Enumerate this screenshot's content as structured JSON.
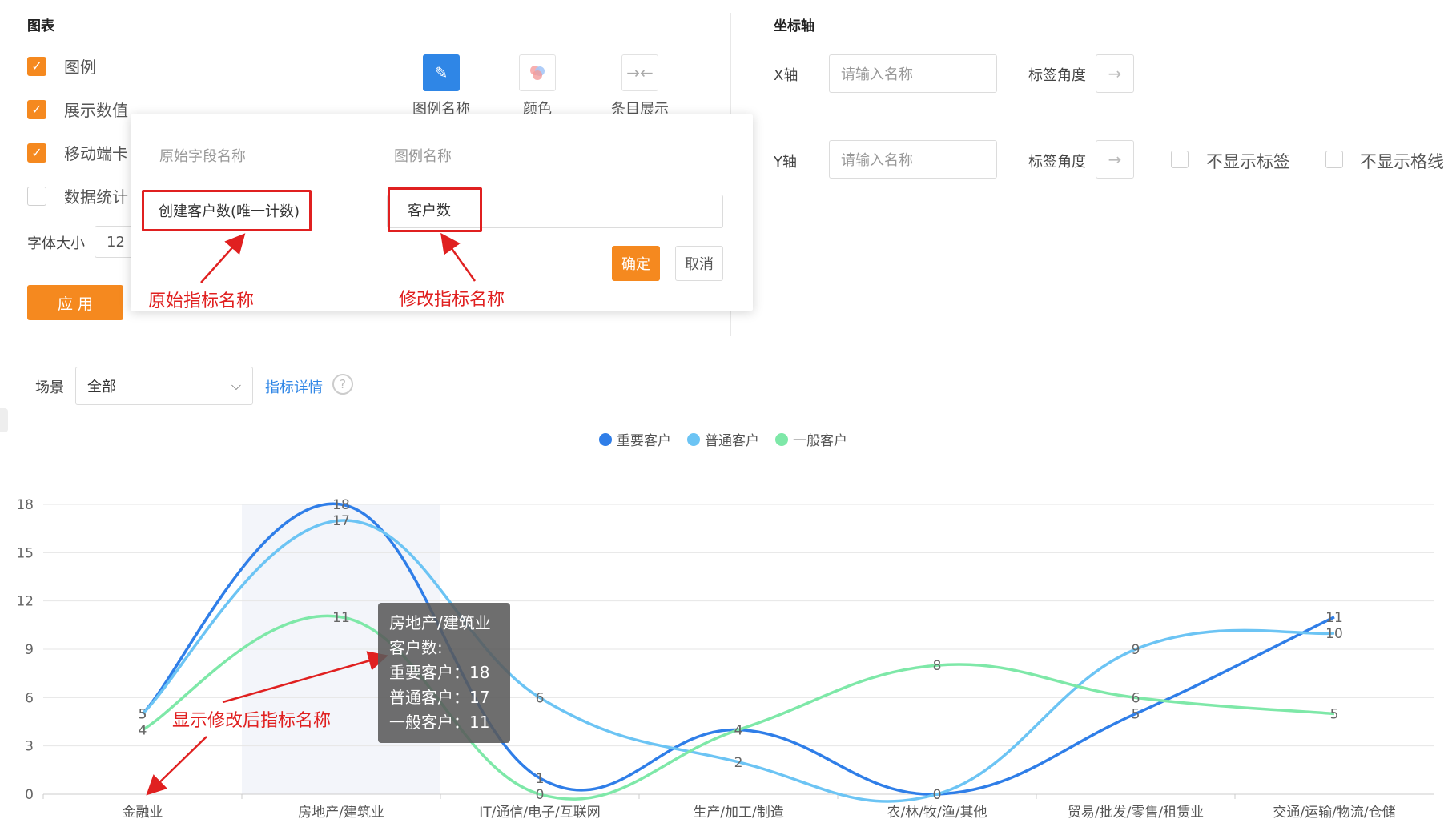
{
  "chart_panel": {
    "title": "图表",
    "checkboxes": [
      {
        "label": "图例",
        "checked": true
      },
      {
        "label": "展示数值",
        "checked": true
      },
      {
        "label": "移动端卡",
        "checked": true
      },
      {
        "label": "数据统计",
        "checked": false
      }
    ],
    "font_size_label": "字体大小",
    "font_size_value": "12",
    "apply_label": "应 用",
    "tools": [
      {
        "label": "图例名称",
        "icon": "pencil-icon",
        "active": true
      },
      {
        "label": "颜色",
        "icon": "color-palette-icon",
        "active": false
      },
      {
        "label": "条目展示",
        "icon": "collapse-arrows-icon",
        "active": false
      }
    ]
  },
  "axis_panel": {
    "title": "坐标轴",
    "x_label": "X轴",
    "y_label": "Y轴",
    "name_placeholder": "请输入名称",
    "angle_label": "标签角度",
    "hide_labels": "不显示标签",
    "hide_grid": "不显示格线"
  },
  "legend_popup": {
    "col_original": "原始字段名称",
    "col_legend": "图例名称",
    "original_field": "创建客户数(唯一计数)",
    "legend_value": "客户数",
    "confirm_label": "确定",
    "cancel_label": "取消",
    "annotation_original": "原始指标名称",
    "annotation_modified": "修改指标名称"
  },
  "scene": {
    "label": "场景",
    "value": "全部",
    "detail_link": "指标详情"
  },
  "annotation_chart": "显示修改后指标名称",
  "tooltip": {
    "category": "房地产/建筑业",
    "metric": "客户数:",
    "rows": [
      "重要客户：18",
      "普通客户：17",
      "一般客户：11"
    ]
  },
  "colors": {
    "orange": "#f5891f",
    "blue_active": "#2f86e6",
    "series1": "#2f7ee8",
    "series2": "#6cc4f4",
    "series3": "#7ee8a8",
    "annotation_red": "#e02020"
  },
  "chart_data": {
    "type": "line",
    "categories": [
      "金融业",
      "房地产/建筑业",
      "IT/通信/电子/互联网",
      "生产/加工/制造",
      "农/林/牧/渔/其他",
      "贸易/批发/零售/租赁业",
      "交通/运输/物流/仓储"
    ],
    "series": [
      {
        "name": "重要客户",
        "values": [
          5,
          18,
          1,
          4,
          0,
          5,
          11
        ]
      },
      {
        "name": "普通客户",
        "values": [
          5,
          17,
          6,
          2,
          0,
          9,
          10
        ]
      },
      {
        "name": "一般客户",
        "values": [
          4,
          11,
          0,
          4,
          8,
          6,
          5
        ]
      }
    ],
    "yticks": [
      0,
      3,
      6,
      9,
      12,
      15,
      18
    ],
    "ylim": [
      0,
      18
    ],
    "legend_position": "top-center",
    "grid": true,
    "highlight_index": 1
  }
}
